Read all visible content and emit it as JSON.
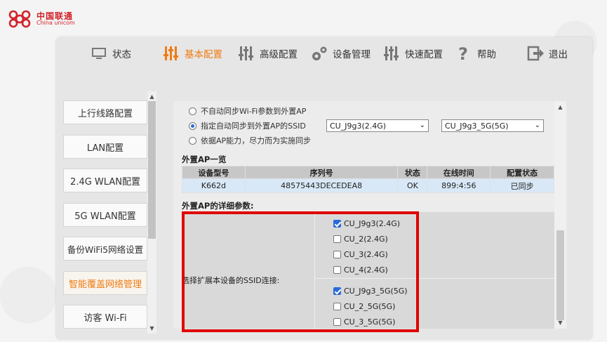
{
  "brand": {
    "name_cn": "中国联通",
    "name_en": "China unicom",
    "color": "#d2232a"
  },
  "topnav": {
    "items": [
      {
        "label": "状态",
        "icon": "monitor-icon"
      },
      {
        "label": "基本配置",
        "icon": "sliders-icon",
        "active": true
      },
      {
        "label": "高级配置",
        "icon": "sliders-icon"
      },
      {
        "label": "设备管理",
        "icon": "gears-icon"
      },
      {
        "label": "快速配置",
        "icon": "sliders-icon"
      },
      {
        "label": "帮助",
        "icon": "help-icon"
      },
      {
        "label": "退出",
        "icon": "logout-icon"
      }
    ],
    "active_color": "#f07c14"
  },
  "sidebar": {
    "items": [
      {
        "label": "上行线路配置"
      },
      {
        "label": "LAN配置"
      },
      {
        "label": "2.4G WLAN配置"
      },
      {
        "label": "5G WLAN配置"
      },
      {
        "label": "备份WiFi5网络设置"
      },
      {
        "label": "智能覆盖网络管理",
        "active": true
      },
      {
        "label": "访客 Wi-Fi"
      }
    ]
  },
  "sync": {
    "options": [
      {
        "label": "不自动同步Wi-Fi参数到外置AP",
        "checked": false
      },
      {
        "label": "指定自动同步到外置AP的SSID",
        "checked": true
      },
      {
        "label": "依据AP能力，尽力而为实施同步",
        "checked": false
      }
    ],
    "ssid_24g_selected": "CU_J9g3(2.4G)",
    "ssid_5g_selected": "CU_J9g3_5G(5G)"
  },
  "ap_list": {
    "title": "外置AP一览",
    "columns": [
      "设备型号",
      "序列号",
      "状态",
      "在线时间",
      "配置状态"
    ],
    "rows": [
      [
        "K662d",
        "48575443DECEDEA8",
        "OK",
        "899:4:56",
        "已同步"
      ]
    ]
  },
  "detail": {
    "title": "外置AP的详细参数:",
    "label": "选择扩展本设备的SSID连接:",
    "ssids_24g": [
      {
        "label": "CU_J9g3(2.4G)",
        "checked": true
      },
      {
        "label": "CU_2(2.4G)",
        "checked": false
      },
      {
        "label": "CU_3(2.4G)",
        "checked": false
      },
      {
        "label": "CU_4(2.4G)",
        "checked": false
      }
    ],
    "ssids_5g": [
      {
        "label": "CU_J9g3_5G(5G)",
        "checked": true
      },
      {
        "label": "CU_2_5G(5G)",
        "checked": false
      },
      {
        "label": "CU_3_5G(5G)",
        "checked": false
      }
    ]
  },
  "highlight_color": "#e00000"
}
